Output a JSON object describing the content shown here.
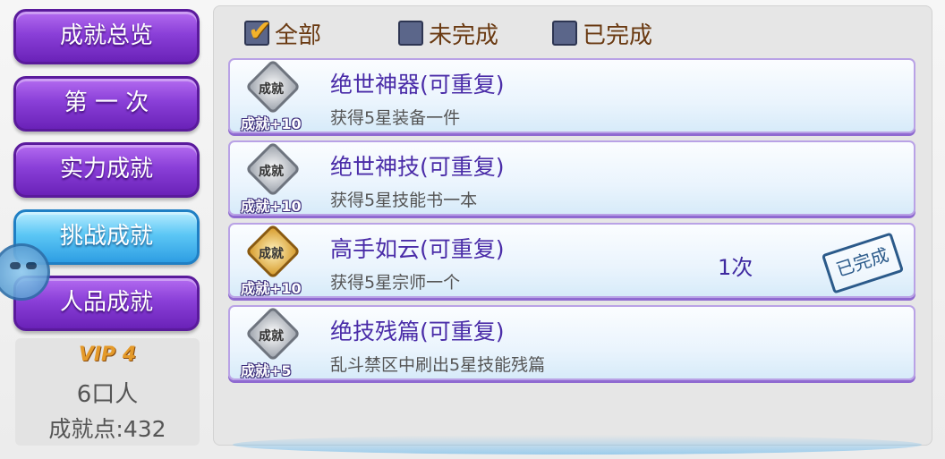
{
  "nav": {
    "items": [
      {
        "label": "成就总览"
      },
      {
        "label": "第 一 次"
      },
      {
        "label": "实力成就"
      },
      {
        "label": "挑战成就"
      },
      {
        "label": "人品成就"
      }
    ]
  },
  "player": {
    "vip_label": "VIP 4",
    "name": "6口人",
    "points_text": "成就点:432"
  },
  "filters": [
    {
      "label": "全部",
      "checked": true
    },
    {
      "label": "未完成",
      "checked": false
    },
    {
      "label": "已完成",
      "checked": false
    }
  ],
  "achievements": [
    {
      "title": "绝世神器(可重复)",
      "desc": "获得5星装备一件",
      "badge_text": "成就",
      "bonus": "成就+10",
      "count": "",
      "stamp": "",
      "badge_color": "silver"
    },
    {
      "title": "绝世神技(可重复)",
      "desc": "获得5星技能书一本",
      "badge_text": "成就",
      "bonus": "成就+10",
      "count": "",
      "stamp": "",
      "badge_color": "silver"
    },
    {
      "title": "高手如云(可重复)",
      "desc": "获得5星宗师一个",
      "badge_text": "成就",
      "bonus": "成就+10",
      "count": "1次",
      "stamp": "已完成",
      "badge_color": "gold"
    },
    {
      "title": "绝技残篇(可重复)",
      "desc": "乱斗禁区中刷出5星技能残篇",
      "badge_text": "成就",
      "bonus": "成就+5",
      "count": "",
      "stamp": "",
      "badge_color": "silver"
    }
  ]
}
